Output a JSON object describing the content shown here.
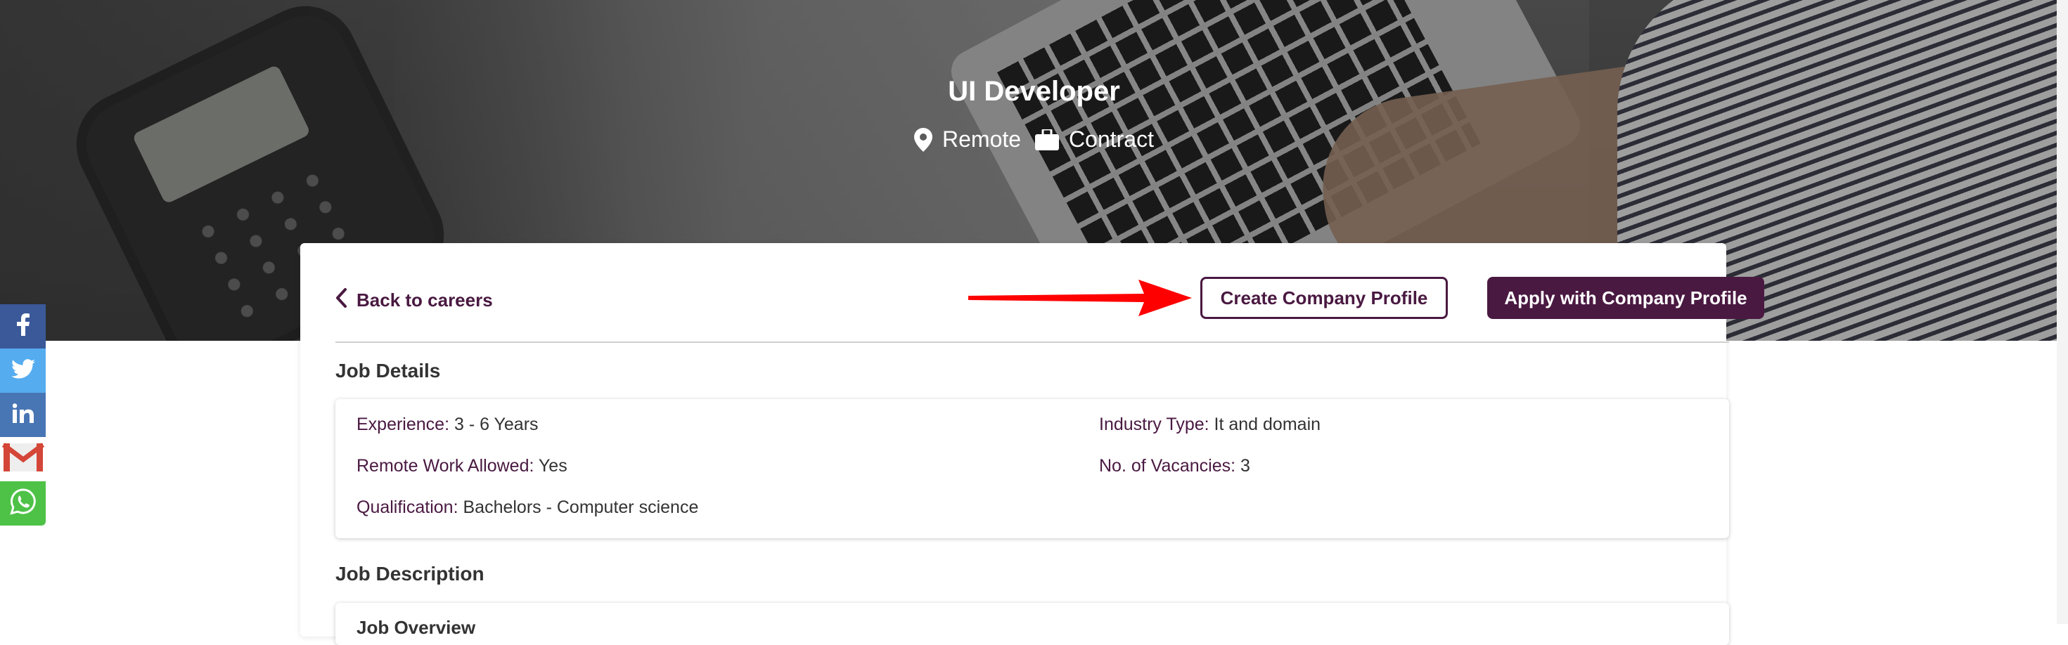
{
  "hero": {
    "job_title": "UI Developer",
    "location": "Remote",
    "job_type": "Contract"
  },
  "share": {
    "items": [
      "facebook-icon",
      "twitter-icon",
      "linkedin-icon",
      "gmail-icon",
      "whatsapp-icon"
    ],
    "colors": {
      "facebook": "#3b5998",
      "twitter": "#55acee",
      "linkedin": "#4875b4",
      "gmail": "#d44638",
      "whatsapp": "#4dc247"
    }
  },
  "toolbar": {
    "back_label": "Back to careers",
    "create_label": "Create Company Profile",
    "apply_label": "Apply with Company Profile"
  },
  "job_details": {
    "heading": "Job Details",
    "experience_label": "Experience:",
    "experience_value": "3 - 6 Years",
    "industry_label": "Industry Type:",
    "industry_value": "It and domain",
    "remote_label": "Remote Work Allowed:",
    "remote_value": "Yes",
    "vacancies_label": "No. of Vacancies:",
    "vacancies_value": "3",
    "qualification_label": "Qualification:",
    "qualification_value": "Bachelors - Computer science"
  },
  "job_description": {
    "heading": "Job Description",
    "subheading": "Job Overview"
  },
  "theme": {
    "brand": "#4a1942",
    "annotation_arrow": "#ff0000"
  }
}
